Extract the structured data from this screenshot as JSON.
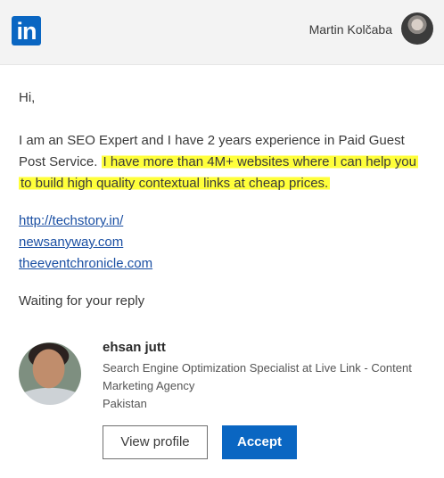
{
  "header": {
    "logo_text": "in",
    "user_name": "Martin Kolčaba"
  },
  "message": {
    "greeting": "Hi,",
    "paragraph_plain": "I am an SEO Expert and I have 2 years experience in Paid Guest Post Service. ",
    "paragraph_highlighted": "I have more than 4M+ websites where I can help you to build high quality contextual links at cheap prices.",
    "links": [
      "http://techstory.in/",
      "newsanyway.com",
      "theeventchronicle.com"
    ],
    "closing": "Waiting for your reply"
  },
  "profile": {
    "name": "ehsan jutt",
    "title": "Search Engine Optimization Specialist at Live Link - Content Marketing Agency",
    "location": "Pakistan"
  },
  "actions": {
    "view_profile_label": "View profile",
    "accept_label": "Accept"
  },
  "colors": {
    "brand": "#0a66c2",
    "highlight": "#ffff3a",
    "link": "#1a4fa3"
  }
}
